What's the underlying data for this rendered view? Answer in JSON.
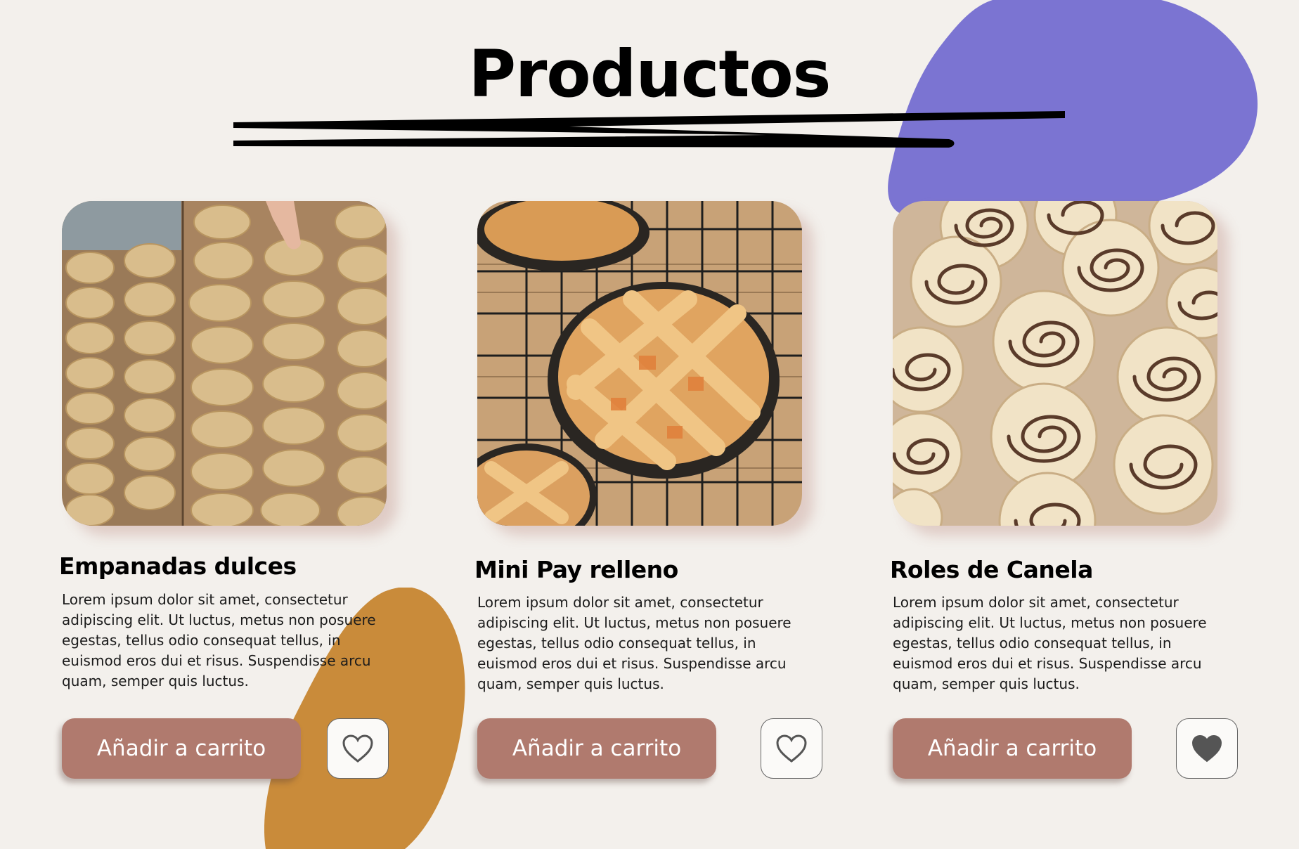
{
  "page": {
    "title": "Productos"
  },
  "colors": {
    "background": "#f3f0ec",
    "accent_purple": "#7b74d2",
    "accent_orange": "#c98b3a",
    "button": "#b07a6e",
    "button_text": "#ffffff",
    "heart_filled": "#555555"
  },
  "products": [
    {
      "name": "Empanadas dulces",
      "description": "Lorem ipsum dolor sit amet, consectetur adipiscing elit. Ut luctus, metus non posuere egestas, tellus odio consequat tellus, in euismod eros dui et risus. Suspendisse arcu quam, semper quis luctus.",
      "add_label": "Añadir a carrito",
      "favorite": false,
      "favorite_icon": "heart-outline-icon"
    },
    {
      "name": "Mini Pay relleno",
      "description": "Lorem ipsum dolor sit amet, consectetur adipiscing elit. Ut luctus, metus non posuere egestas, tellus odio consequat tellus, in euismod eros dui et risus. Suspendisse arcu quam, semper quis luctus.",
      "add_label": "Añadir a carrito",
      "favorite": false,
      "favorite_icon": "heart-outline-icon"
    },
    {
      "name": "Roles de Canela",
      "description": "Lorem ipsum dolor sit amet, consectetur adipiscing elit. Ut luctus, metus non posuere egestas, tellus odio consequat tellus, in euismod eros dui et risus. Suspendisse arcu quam, semper quis luctus.",
      "add_label": "Añadir a carrito",
      "favorite": true,
      "favorite_icon": "heart-filled-icon"
    }
  ]
}
